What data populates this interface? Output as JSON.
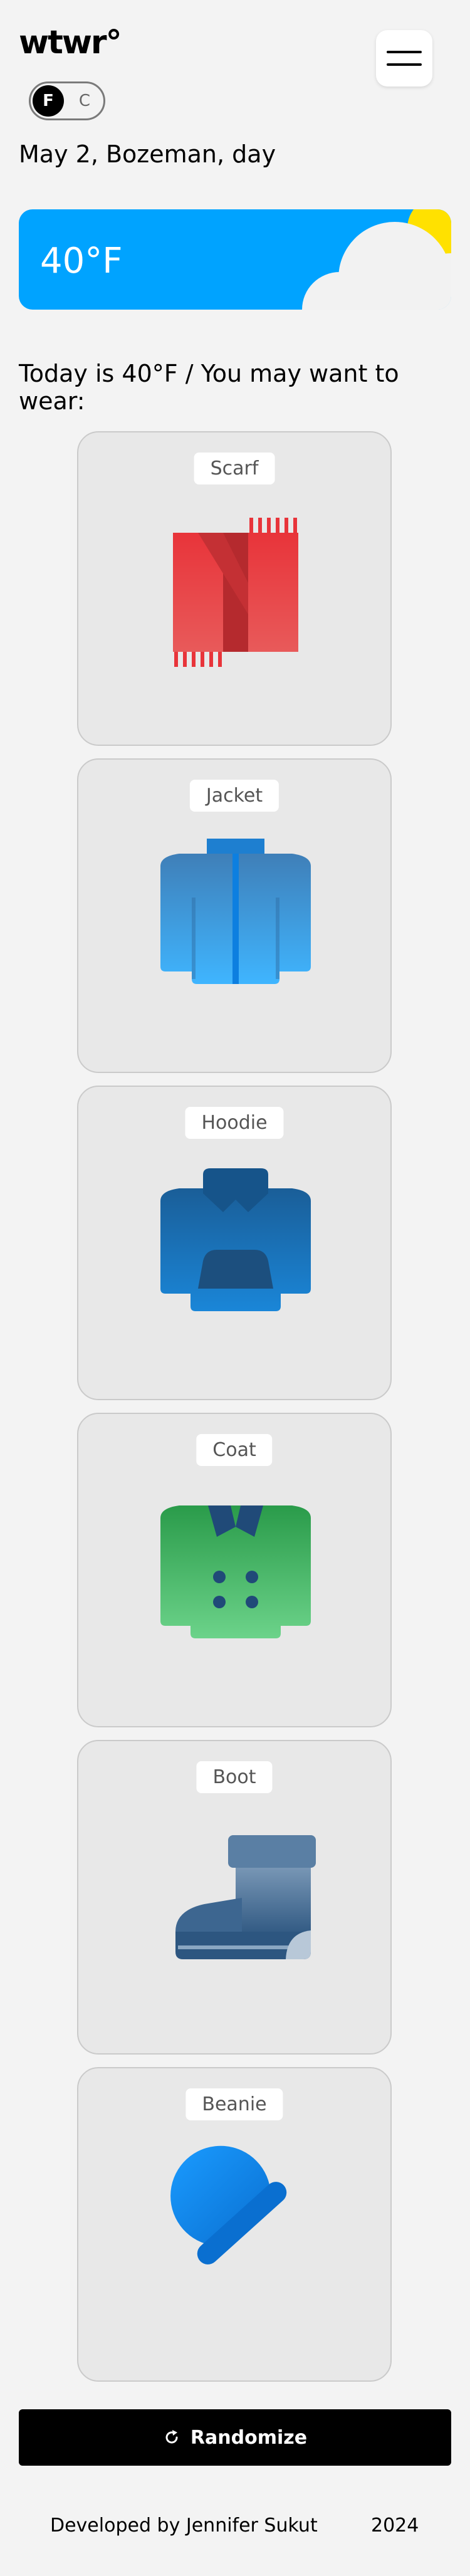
{
  "header": {
    "logo": "wtwr°",
    "unit_toggle": {
      "option_f": "F",
      "option_c": "C",
      "selected": "F"
    },
    "date_location": "May 2, Bozeman, day"
  },
  "weather": {
    "temperature": "40°F",
    "condition": "cloudy-day",
    "colors": {
      "sky": "#00a3ff",
      "sun": "#ffe100",
      "cloud": "#f2f2f2"
    }
  },
  "main": {
    "heading": "Today is 40°F / You may want to wear:",
    "items": [
      {
        "label": "Scarf",
        "icon": "scarf-icon"
      },
      {
        "label": "Jacket",
        "icon": "jacket-icon"
      },
      {
        "label": "Hoodie",
        "icon": "hoodie-icon"
      },
      {
        "label": "Coat",
        "icon": "coat-icon"
      },
      {
        "label": "Boot",
        "icon": "boot-icon"
      },
      {
        "label": "Beanie",
        "icon": "beanie-icon"
      }
    ],
    "randomize_label": "Randomize"
  },
  "footer": {
    "developer": "Developed by Jennifer Sukut",
    "year": "2024"
  }
}
